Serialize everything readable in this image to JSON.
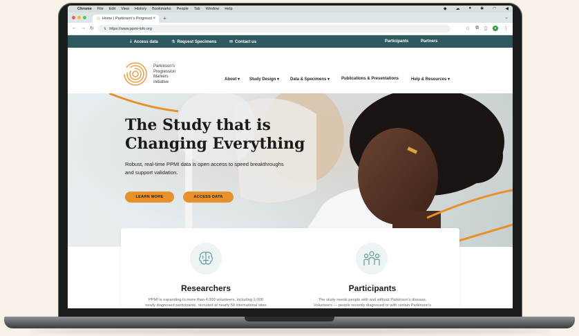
{
  "menubar": {
    "app": "Chrome",
    "items": [
      "File",
      "Edit",
      "View",
      "History",
      "Bookmarks",
      "People",
      "Tab",
      "Window",
      "Help"
    ]
  },
  "browser": {
    "tab_title": "Home | Parkinson's Progressi",
    "tab_close": "×",
    "new_tab": "+",
    "url": "https://www.ppmi-info.org"
  },
  "utility_nav": {
    "access_data": "Access data",
    "request_specimens": "Request Specimens",
    "contact_us": "Contact us",
    "participants": "Participants",
    "partners": "Partners"
  },
  "header": {
    "logo_text": [
      "Parkinson's",
      "Progression",
      "Markers",
      "Initiative"
    ],
    "nav": [
      "About ▾",
      "Study Design ▾",
      "Data & Specimens ▾",
      "Publications & Presentations",
      "Help & Resources ▾"
    ]
  },
  "hero": {
    "title_line1": "The Study that is",
    "title_line2": "Changing Everything",
    "subtitle_line1": "Robust, real-time PPMI data is open access to speed breakthroughs",
    "subtitle_line2": "and support validation.",
    "learn_more": "LEARN MORE",
    "access_data": "ACCESS DATA"
  },
  "cards": {
    "researchers_title": "Researchers",
    "researchers_text_1": "PPMI is expanding to more than 4,000 volunteers, including 2,000",
    "researchers_text_2": "newly diagnosed participants, recruited at nearly 50 international sites",
    "participants_title": "Participants",
    "participants_text_1": "The study needs people with and without Parkinson's disease.",
    "participants_text_2": "Volunteers — people recently diagnosed or with certain Parkinson's"
  },
  "colors": {
    "teal": "#2d5a5e",
    "orange": "#e8902a",
    "page_bg": "#f7f1e8"
  }
}
